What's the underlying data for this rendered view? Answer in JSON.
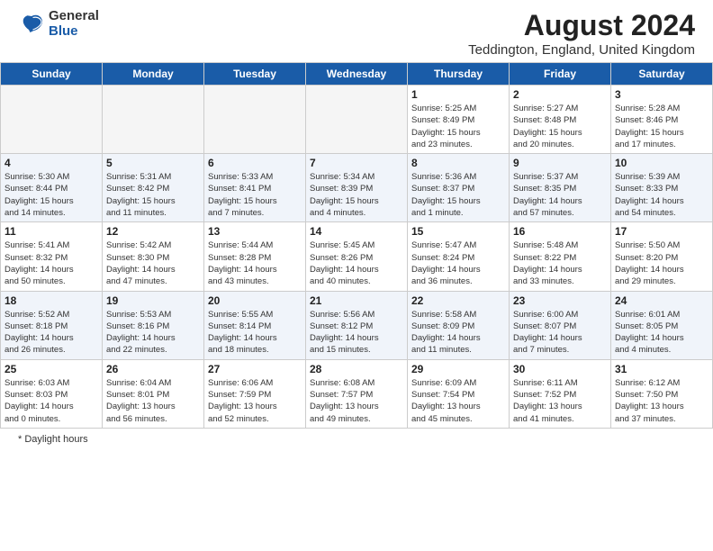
{
  "header": {
    "logo_general": "General",
    "logo_blue": "Blue",
    "month_title": "August 2024",
    "location": "Teddington, England, United Kingdom"
  },
  "days_of_week": [
    "Sunday",
    "Monday",
    "Tuesday",
    "Wednesday",
    "Thursday",
    "Friday",
    "Saturday"
  ],
  "weeks": [
    [
      {
        "day": "",
        "info": ""
      },
      {
        "day": "",
        "info": ""
      },
      {
        "day": "",
        "info": ""
      },
      {
        "day": "",
        "info": ""
      },
      {
        "day": "1",
        "info": "Sunrise: 5:25 AM\nSunset: 8:49 PM\nDaylight: 15 hours\nand 23 minutes."
      },
      {
        "day": "2",
        "info": "Sunrise: 5:27 AM\nSunset: 8:48 PM\nDaylight: 15 hours\nand 20 minutes."
      },
      {
        "day": "3",
        "info": "Sunrise: 5:28 AM\nSunset: 8:46 PM\nDaylight: 15 hours\nand 17 minutes."
      }
    ],
    [
      {
        "day": "4",
        "info": "Sunrise: 5:30 AM\nSunset: 8:44 PM\nDaylight: 15 hours\nand 14 minutes."
      },
      {
        "day": "5",
        "info": "Sunrise: 5:31 AM\nSunset: 8:42 PM\nDaylight: 15 hours\nand 11 minutes."
      },
      {
        "day": "6",
        "info": "Sunrise: 5:33 AM\nSunset: 8:41 PM\nDaylight: 15 hours\nand 7 minutes."
      },
      {
        "day": "7",
        "info": "Sunrise: 5:34 AM\nSunset: 8:39 PM\nDaylight: 15 hours\nand 4 minutes."
      },
      {
        "day": "8",
        "info": "Sunrise: 5:36 AM\nSunset: 8:37 PM\nDaylight: 15 hours\nand 1 minute."
      },
      {
        "day": "9",
        "info": "Sunrise: 5:37 AM\nSunset: 8:35 PM\nDaylight: 14 hours\nand 57 minutes."
      },
      {
        "day": "10",
        "info": "Sunrise: 5:39 AM\nSunset: 8:33 PM\nDaylight: 14 hours\nand 54 minutes."
      }
    ],
    [
      {
        "day": "11",
        "info": "Sunrise: 5:41 AM\nSunset: 8:32 PM\nDaylight: 14 hours\nand 50 minutes."
      },
      {
        "day": "12",
        "info": "Sunrise: 5:42 AM\nSunset: 8:30 PM\nDaylight: 14 hours\nand 47 minutes."
      },
      {
        "day": "13",
        "info": "Sunrise: 5:44 AM\nSunset: 8:28 PM\nDaylight: 14 hours\nand 43 minutes."
      },
      {
        "day": "14",
        "info": "Sunrise: 5:45 AM\nSunset: 8:26 PM\nDaylight: 14 hours\nand 40 minutes."
      },
      {
        "day": "15",
        "info": "Sunrise: 5:47 AM\nSunset: 8:24 PM\nDaylight: 14 hours\nand 36 minutes."
      },
      {
        "day": "16",
        "info": "Sunrise: 5:48 AM\nSunset: 8:22 PM\nDaylight: 14 hours\nand 33 minutes."
      },
      {
        "day": "17",
        "info": "Sunrise: 5:50 AM\nSunset: 8:20 PM\nDaylight: 14 hours\nand 29 minutes."
      }
    ],
    [
      {
        "day": "18",
        "info": "Sunrise: 5:52 AM\nSunset: 8:18 PM\nDaylight: 14 hours\nand 26 minutes."
      },
      {
        "day": "19",
        "info": "Sunrise: 5:53 AM\nSunset: 8:16 PM\nDaylight: 14 hours\nand 22 minutes."
      },
      {
        "day": "20",
        "info": "Sunrise: 5:55 AM\nSunset: 8:14 PM\nDaylight: 14 hours\nand 18 minutes."
      },
      {
        "day": "21",
        "info": "Sunrise: 5:56 AM\nSunset: 8:12 PM\nDaylight: 14 hours\nand 15 minutes."
      },
      {
        "day": "22",
        "info": "Sunrise: 5:58 AM\nSunset: 8:09 PM\nDaylight: 14 hours\nand 11 minutes."
      },
      {
        "day": "23",
        "info": "Sunrise: 6:00 AM\nSunset: 8:07 PM\nDaylight: 14 hours\nand 7 minutes."
      },
      {
        "day": "24",
        "info": "Sunrise: 6:01 AM\nSunset: 8:05 PM\nDaylight: 14 hours\nand 4 minutes."
      }
    ],
    [
      {
        "day": "25",
        "info": "Sunrise: 6:03 AM\nSunset: 8:03 PM\nDaylight: 14 hours\nand 0 minutes."
      },
      {
        "day": "26",
        "info": "Sunrise: 6:04 AM\nSunset: 8:01 PM\nDaylight: 13 hours\nand 56 minutes."
      },
      {
        "day": "27",
        "info": "Sunrise: 6:06 AM\nSunset: 7:59 PM\nDaylight: 13 hours\nand 52 minutes."
      },
      {
        "day": "28",
        "info": "Sunrise: 6:08 AM\nSunset: 7:57 PM\nDaylight: 13 hours\nand 49 minutes."
      },
      {
        "day": "29",
        "info": "Sunrise: 6:09 AM\nSunset: 7:54 PM\nDaylight: 13 hours\nand 45 minutes."
      },
      {
        "day": "30",
        "info": "Sunrise: 6:11 AM\nSunset: 7:52 PM\nDaylight: 13 hours\nand 41 minutes."
      },
      {
        "day": "31",
        "info": "Sunrise: 6:12 AM\nSunset: 7:50 PM\nDaylight: 13 hours\nand 37 minutes."
      }
    ]
  ],
  "footer": {
    "note": "Daylight hours"
  }
}
